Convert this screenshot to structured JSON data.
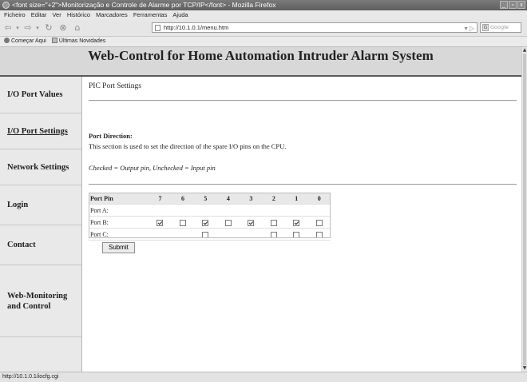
{
  "window": {
    "title": "<font size=\"+2\">Monitorização e Controle de Alarme por TCP/IP</font> - Mozilla Firefox",
    "buttons": [
      "_",
      "▫",
      "x"
    ]
  },
  "menu": [
    "Ficheiro",
    "Editar",
    "Ver",
    "Histórico",
    "Marcadores",
    "Ferramentas",
    "Ajuda"
  ],
  "toolbar": {
    "url": "http://10.1.0.1/menu.htm",
    "search_placeholder": "Google"
  },
  "bookmarks": [
    "Começar Aqui",
    "Últimas Novidades"
  ],
  "page": {
    "header": "Web-Control for Home Automation Intruder Alarm System",
    "nav": [
      {
        "label": "I/O Port Values",
        "active": false
      },
      {
        "label": "I/O Port Settings",
        "active": true
      },
      {
        "label": "Network Settings",
        "active": false
      },
      {
        "label": "Login",
        "active": false
      },
      {
        "label": "Contact",
        "active": false
      },
      {
        "label": "Web-Monitoring and Control",
        "active": false
      }
    ],
    "section_title": "PIC Port Settings",
    "direction_label": "Port Direction:",
    "direction_desc": "This section is used to set the direction of the spare I/O pins on the CPU.",
    "legend": "Checked = Output pin, Unchecked = Input pin",
    "table": {
      "header_label": "Port Pin",
      "pins": [
        "7",
        "6",
        "5",
        "4",
        "3",
        "2",
        "1",
        "0"
      ],
      "rows": [
        {
          "label": "Port A:",
          "cells": [
            null,
            null,
            null,
            null,
            null,
            null,
            null,
            null
          ]
        },
        {
          "label": "Port B:",
          "cells": [
            true,
            false,
            true,
            false,
            true,
            false,
            true,
            false
          ]
        },
        {
          "label": "Port C:",
          "cells": [
            null,
            null,
            false,
            null,
            null,
            false,
            false,
            false
          ]
        }
      ]
    },
    "submit_label": "Submit"
  },
  "status": "http://10.1.0.1/iocfg.cgi"
}
